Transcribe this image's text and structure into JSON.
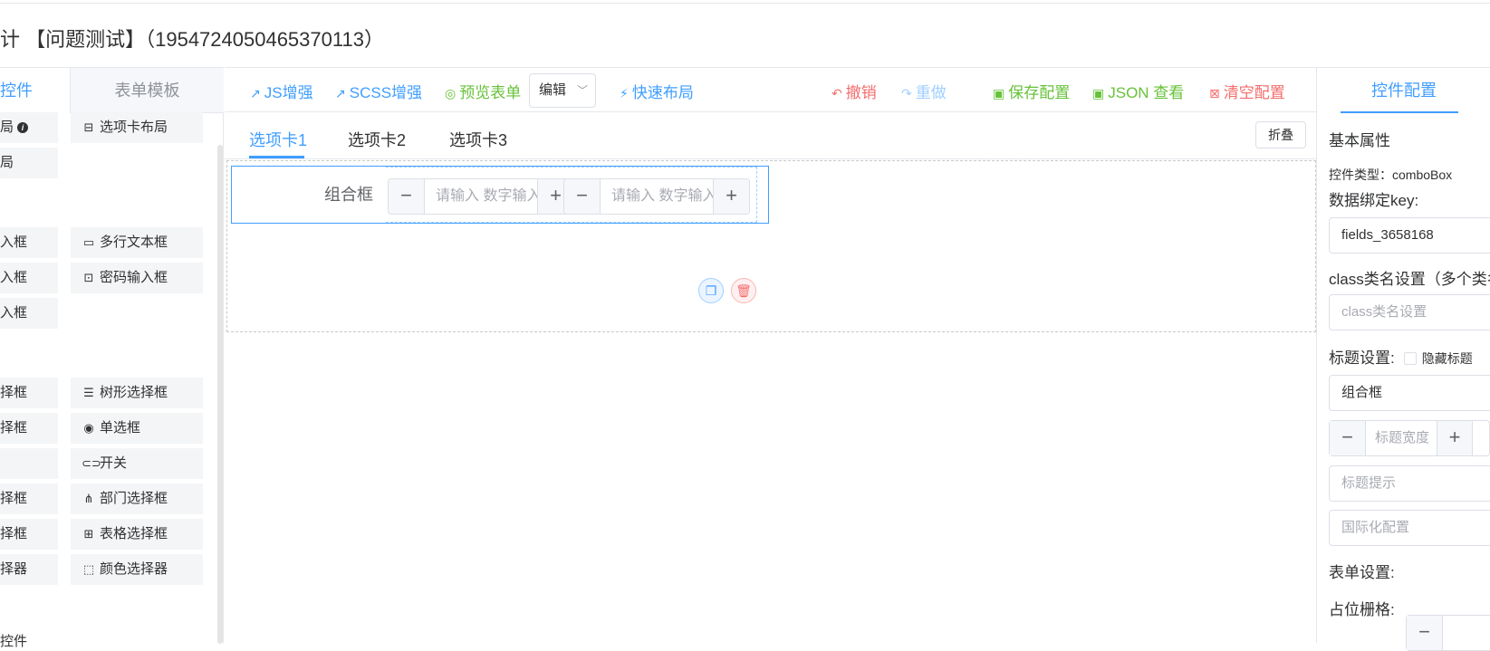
{
  "page_title": "计 【问题测试】（1954724050465370113）",
  "left_panel": {
    "tabs": {
      "components": "控件",
      "templates": "表单模板"
    },
    "left_items": [
      "局",
      "局",
      "入框",
      "入框",
      "入框",
      "择框",
      "择框",
      "",
      "择框",
      "择框",
      "择器"
    ],
    "right_items": [
      {
        "icon": "tab-layout-icon",
        "glyph": "⊟",
        "label": "选项卡布局"
      },
      {
        "icon": "textarea-icon",
        "glyph": "▭",
        "label": "多行文本框"
      },
      {
        "icon": "password-icon",
        "glyph": "⊡",
        "label": "密码输入框"
      },
      {
        "icon": "tree-select-icon",
        "glyph": "☰",
        "label": "树形选择框"
      },
      {
        "icon": "radio-icon",
        "glyph": "◉",
        "label": "单选框"
      },
      {
        "icon": "switch-icon",
        "glyph": "⊂⊃",
        "label": "开关"
      },
      {
        "icon": "department-icon",
        "glyph": "⋔",
        "label": "部门选择框"
      },
      {
        "icon": "table-select-icon",
        "glyph": "⊞",
        "label": "表格选择框"
      },
      {
        "icon": "color-picker-icon",
        "glyph": "⬚",
        "label": "颜色选择器"
      }
    ],
    "section_label": "控件"
  },
  "toolbar": {
    "js": "JS增强",
    "scss": "SCSS增强",
    "preview": "预览表单",
    "mode": "编辑",
    "quick_layout": "快速布局",
    "undo": "撤销",
    "redo": "重做",
    "save": "保存配置",
    "json": "JSON 查看",
    "clear": "清空配置"
  },
  "canvas": {
    "tabs": [
      "选项卡1",
      "选项卡2",
      "选项卡3"
    ],
    "collapse": "折叠",
    "field_label": "组合框",
    "input_placeholder": "请输入 数字输入框"
  },
  "right_panel": {
    "tab": "控件配置",
    "basic": "基本属性",
    "control_type": "控件类型：comboBox",
    "key_label": "数据绑定key:",
    "key_value": "fields_3658168",
    "class_label": "class类名设置（多个类名",
    "class_placeholder": "class类名设置",
    "title_label": "标题设置:",
    "hide_title": "隐藏标题",
    "title_value": "组合框",
    "title_width_placeholder": "标题宽度",
    "title_tip_placeholder": "标题提示",
    "i18n_placeholder": "国际化配置",
    "form_label": "表单设置:",
    "grid_label": "占位栅格:"
  },
  "colors": {
    "primary": "#409eff",
    "success": "#67c23a",
    "danger": "#f56c6c"
  }
}
